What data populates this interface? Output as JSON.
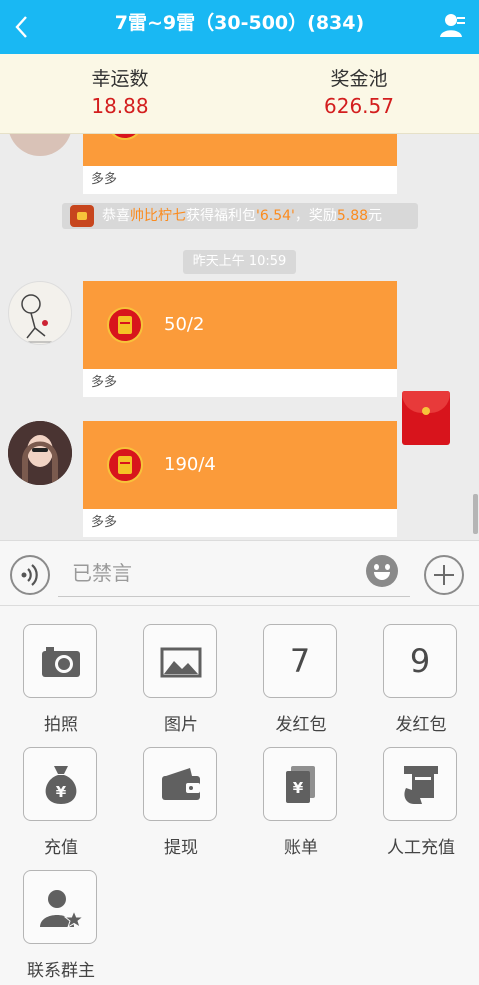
{
  "header": {
    "title": "7雷~9雷（30-500）(834)",
    "color": "#19b8f3"
  },
  "stats": {
    "lucky_label": "幸运数",
    "lucky_value": "18.88",
    "pool_label": "奖金池",
    "pool_value": "626.57"
  },
  "messages": [
    {
      "caption": "多多"
    },
    {
      "amount": "50/2",
      "caption": "多多"
    },
    {
      "amount": "190/4",
      "caption": "多多"
    }
  ],
  "notice": {
    "prefix": "恭喜",
    "name": "帅比柠七",
    "mid": "获得福利包",
    "amount": "'6.54'",
    "reward_label": "，奖励",
    "reward": "5.88",
    "suffix": "元"
  },
  "timestamp": "昨天上午 10:59",
  "input": {
    "placeholder": "已禁言"
  },
  "tools": [
    {
      "label": "拍照",
      "icon": "camera-icon"
    },
    {
      "label": "图片",
      "icon": "image-icon"
    },
    {
      "label": "发红包",
      "number": "7",
      "icon": "number-7"
    },
    {
      "label": "发红包",
      "number": "9",
      "icon": "number-9"
    },
    {
      "label": "充值",
      "icon": "money-bag-icon"
    },
    {
      "label": "提现",
      "icon": "wallet-icon"
    },
    {
      "label": "账单",
      "icon": "bill-icon"
    },
    {
      "label": "人工充值",
      "icon": "card-hand-icon"
    },
    {
      "label": "联系群主",
      "icon": "contact-owner-icon"
    }
  ]
}
